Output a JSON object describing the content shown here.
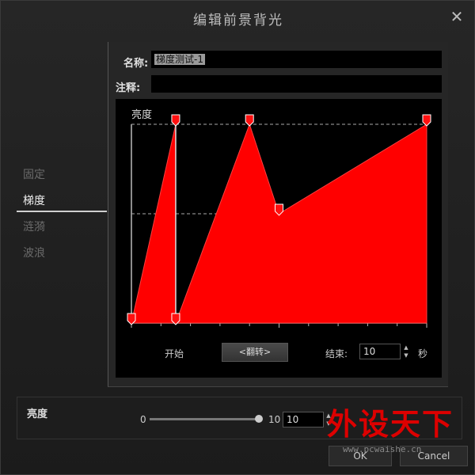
{
  "window": {
    "title": "编辑前景背光"
  },
  "modes": [
    {
      "label": "固定",
      "active": false
    },
    {
      "label": "梯度",
      "active": true
    },
    {
      "label": "涟漪",
      "active": false
    },
    {
      "label": "波浪",
      "active": false
    }
  ],
  "form": {
    "name_label": "名称:",
    "name_value": "梯度测试-1",
    "note_label": "注释:",
    "note_value": ""
  },
  "chart_data": {
    "type": "area",
    "ylabel": "亮度",
    "color": "#ff0000",
    "x": [
      0,
      0.15,
      0.15,
      0.4,
      0.5,
      1.0
    ],
    "y": [
      0,
      1.0,
      0,
      1.0,
      0.55,
      1.0
    ],
    "xlim": [
      0,
      1
    ],
    "ylim": [
      0,
      1
    ],
    "reference_lines": [
      1.0,
      0.55
    ]
  },
  "controls": {
    "start_label": "开始",
    "flip_label": "<翻转>",
    "end_label": "结束:",
    "end_value": "10",
    "end_unit": "秒"
  },
  "brightness": {
    "title": "亮度",
    "min": "0",
    "max": "10",
    "value": "10",
    "level_fraction": 1.0
  },
  "buttons": {
    "ok": "OK",
    "cancel": "Cancel"
  },
  "watermark": {
    "text": "外设天下",
    "url": "www.pcwaishe.cn"
  }
}
